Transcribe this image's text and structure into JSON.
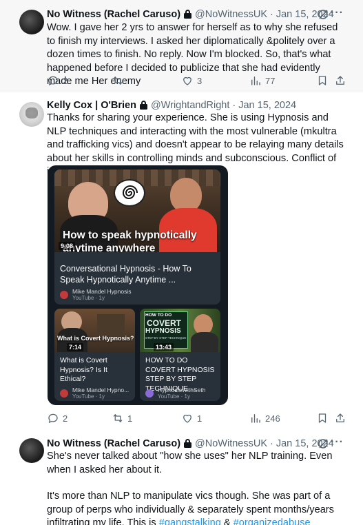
{
  "tweets": [
    {
      "name": "No Witness (Rachel Caruso)",
      "handle": "@NoWitnessUK",
      "date": "Jan 15, 2024",
      "text": "Wow. I gave her 2 yrs to answer for herself as to why she refused to finish my interviews. I asked her diplomatically &politely over a dozen times to finish. No reply. Now I'm blocked. So, that's what happened before I decided to publicize that she had evidently made me Her enemy",
      "replies": "2",
      "reposts": "",
      "likes": "3",
      "views": "77"
    },
    {
      "name": "Kelly Cox | O'Brien",
      "handle": "@WrightandRight",
      "date": "Jan 15, 2024",
      "text": "Thanks for sharing your experience. She is using Hypnosis and NLP techniques and interacting with the most vulnerable (mkultra and trafficking vics) and doesn't appear to be relaying many details about her skills in controlling minds and subconscious. Conflict of interest?",
      "replies": "2",
      "reposts": "1",
      "likes": "1",
      "views": "246",
      "videos": [
        {
          "thumb_title": "How to speak hypnotically anytime anywhere",
          "duration": "9:08",
          "title": "Conversational Hypnosis - How To Speak Hypnotically Anytime ...",
          "channel": "Mike Mandel Hypnosis",
          "meta": "YouTube · 1y"
        },
        {
          "thumb_title": "What is Covert Hypnosis?",
          "duration": "7:14",
          "title": "What is Covert Hypnosis? Is It Ethical?",
          "channel": "Mike Mandel Hypno...",
          "meta": "YouTube · 1y"
        },
        {
          "thumb_top": "HOW TO DO",
          "thumb_title_1": "COVERT",
          "thumb_title_2": "HYPNOSIS",
          "thumb_sub": "STEP BY STEP TECHNIQUE",
          "duration": "13:43",
          "title": "HOW TO DO COVERT HYPNOSIS STEP BY STEP TECHNIQUE ...",
          "channel": "HypnosisWithSeth",
          "meta": "YouTube · 1y"
        }
      ]
    },
    {
      "name": "No Witness (Rachel Caruso)",
      "handle": "@NoWitnessUK",
      "date": "Jan 15, 2024",
      "text_p1": "She's never talked about \"how she uses\" her NLP training. Even when I asked her about it.",
      "text_p2": "It's more than NLP to manipulate vics though. She was part of a group of perps who individually & separately spent months/years infiltrating my life. This is ",
      "hashtag1": "#gangstalking",
      "amp": " & ",
      "hashtag2": "#organizedabuse"
    }
  ],
  "ui": {
    "dot": "·",
    "more": "···"
  },
  "colors": {
    "link": "#1d9bf0",
    "muted": "#536471",
    "text": "#0f1419",
    "highlight_bg": "#f7f7f7"
  },
  "icons": [
    "lock-icon",
    "grok-icon",
    "more-icon",
    "reply-icon",
    "repost-icon",
    "like-icon",
    "views-icon",
    "bookmark-icon",
    "share-icon"
  ]
}
